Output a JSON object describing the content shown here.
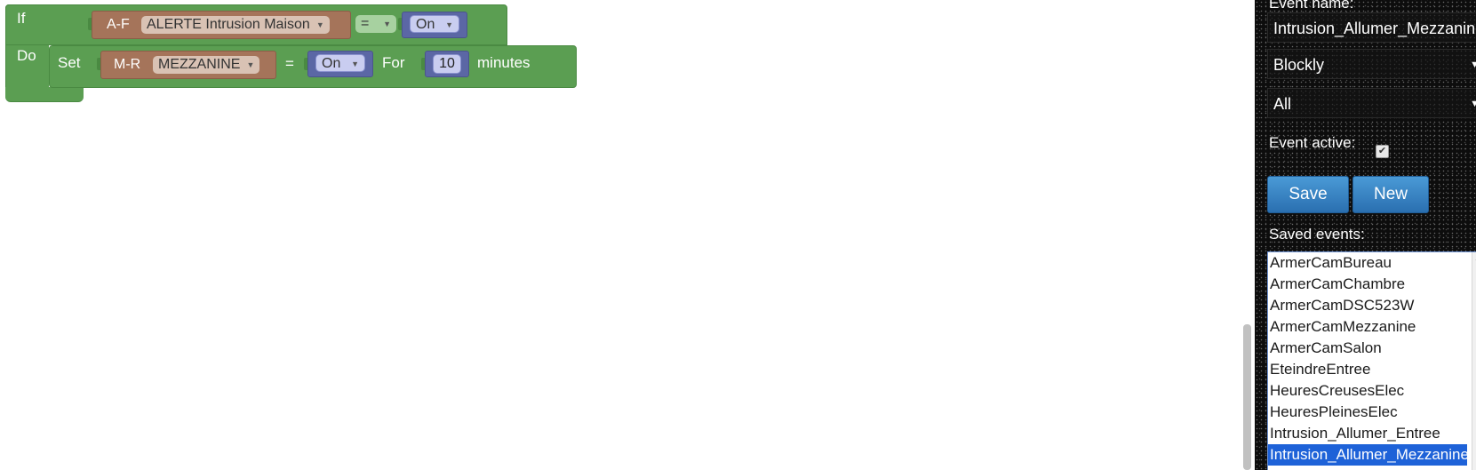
{
  "blockly": {
    "if_label": "If",
    "do_label": "Do",
    "condition": {
      "device_type": "A-F",
      "device_name": "ALERTE Intrusion Maison",
      "operator": "=",
      "value": "On"
    },
    "action": {
      "set_label": "Set",
      "device_type": "M-R",
      "device_name": "MEZZANINE",
      "equals": "=",
      "value": "On",
      "for_label": "For",
      "duration": "10",
      "unit": "minutes"
    }
  },
  "sidebar": {
    "event_name_label": "Event name:",
    "event_name_value": "Intrusion_Allumer_Mezzanine",
    "type_select": "Blockly",
    "scope_select": "All",
    "event_active_label": "Event active:",
    "event_active_checked": true,
    "checkmark": "✔",
    "save_label": "Save",
    "new_label": "New",
    "saved_events_label": "Saved events:",
    "saved_events": [
      "ArmerCamBureau",
      "ArmerCamChambre",
      "ArmerCamDSC523W",
      "ArmerCamMezzanine",
      "ArmerCamSalon",
      "EteindreEntree",
      "HeuresCreusesElec",
      "HeuresPleinesElec",
      "Intrusion_Allumer_Entree",
      "Intrusion_Allumer_Mezzanine"
    ],
    "selected_event": "Intrusion_Allumer_Mezzanine"
  },
  "icons": {
    "dropdown_arrow": "▼",
    "select_caret": "▼",
    "scroll_up": "▲"
  },
  "colors": {
    "logic_block": "#5b9e52",
    "device_block": "#a5745a",
    "value_block": "#5b67a5",
    "button": "#2a6fb0",
    "selection": "#1e62d8"
  }
}
